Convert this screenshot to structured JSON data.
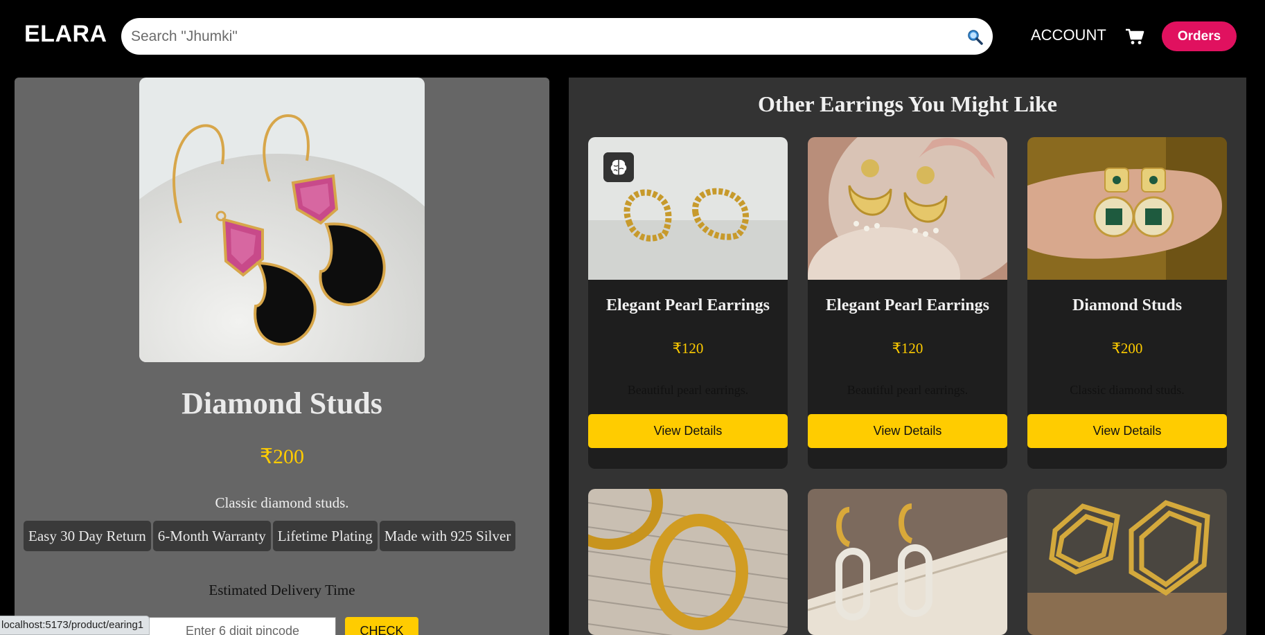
{
  "header": {
    "logo": "ELARA",
    "search_placeholder": "Search \"Jhumki\"",
    "account_label": "ACCOUNT",
    "orders_label": "Orders",
    "accent_color": "#e0115f"
  },
  "product": {
    "title": "Diamond Studs",
    "price": "₹200",
    "description": "Classic diamond studs.",
    "badges": [
      "Easy 30 Day Return",
      "6-Month Warranty",
      "Lifetime Plating",
      "Made with 925 Silver"
    ],
    "delivery_label": "Estimated Delivery Time",
    "pincode_placeholder": "Enter 6 digit pincode",
    "check_label": "CHECK"
  },
  "recommendations": {
    "title": "Other Earrings You Might Like",
    "cards": [
      {
        "title": "Elegant Pearl Earrings",
        "price": "₹120",
        "description": "Beautiful pearl earrings.",
        "button": "View Details"
      },
      {
        "title": "Elegant Pearl Earrings",
        "price": "₹120",
        "description": "Beautiful pearl earrings.",
        "button": "View Details"
      },
      {
        "title": "Diamond Studs",
        "price": "₹200",
        "description": "Classic diamond studs.",
        "button": "View Details"
      }
    ]
  },
  "status_bar": {
    "url": "localhost:5173/product/earing1"
  },
  "colors": {
    "price": "#ffcc00",
    "button": "#ffcc00"
  }
}
